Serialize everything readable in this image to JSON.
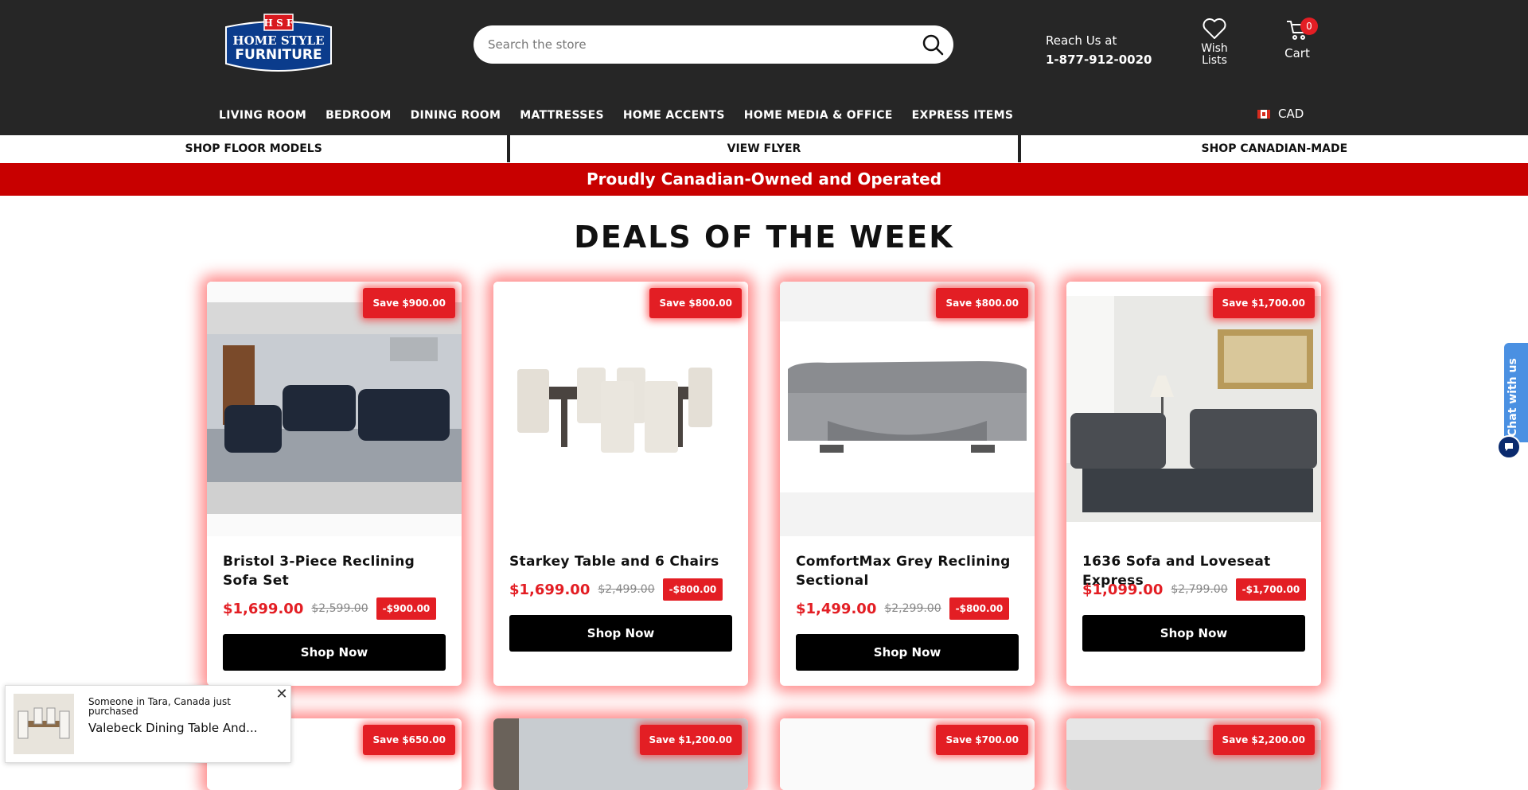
{
  "header": {
    "logo_text": {
      "top": "H S F",
      "line1": "HOME STYLE",
      "line2": "FURNITURE"
    },
    "search_placeholder": "Search the store",
    "reach": {
      "label": "Reach Us at",
      "phone": "1-877-912-0020"
    },
    "wishlist": {
      "line1": "Wish",
      "line2": "Lists"
    },
    "cart": {
      "label": "Cart",
      "count": "0"
    },
    "nav": [
      "LIVING ROOM",
      "BEDROOM",
      "DINING ROOM",
      "MATTRESSES",
      "HOME ACCENTS",
      "HOME MEDIA & OFFICE",
      "EXPRESS ITEMS"
    ],
    "currency": "CAD"
  },
  "subnav": [
    "SHOP FLOOR MODELS",
    "VIEW FLYER",
    "SHOP CANADIAN-MADE"
  ],
  "banner": "Proudly Canadian-Owned and Operated",
  "deals_title": "DEALS OF THE WEEK",
  "products": [
    {
      "save": "Save $900.00",
      "name": "Bristol 3-Piece Reclining Sofa Set",
      "price": "$1,699.00",
      "old": "$2,599.00",
      "off": "-$900.00",
      "button": "Shop Now"
    },
    {
      "save": "Save $800.00",
      "name": "Starkey Table and 6 Chairs",
      "price": "$1,699.00",
      "old": "$2,499.00",
      "off": "-$800.00",
      "button": "Shop Now"
    },
    {
      "save": "Save $800.00",
      "name": "ComfortMax Grey Reclining Sectional",
      "price": "$1,499.00",
      "old": "$2,299.00",
      "off": "-$800.00",
      "button": "Shop Now"
    },
    {
      "save": "Save $1,700.00",
      "name": "1636 Sofa and Loveseat Express",
      "price": "$1,099.00",
      "old": "$2,799.00",
      "off": "-$1,700.00",
      "button": "Shop Now"
    }
  ],
  "second_row_saves": [
    "Save $650.00",
    "Save $1,200.00",
    "Save $700.00",
    "Save $2,200.00"
  ],
  "popup": {
    "line1": "Someone in Tara, Canada just purchased",
    "line2": "Valebeck Dining Table And...",
    "close": "✕"
  },
  "chat": {
    "label": "Chat with us"
  },
  "colors": {
    "header_bg": "#262626",
    "accent_red": "#e31e24",
    "banner_red": "#c80000",
    "button_black": "#000000",
    "chat_blue": "#4a90e2"
  },
  "icons": {
    "search": "search-icon",
    "wishlist": "heart-icon",
    "cart": "cart-icon",
    "close": "close-icon",
    "chat": "chat-bubble-icon"
  }
}
